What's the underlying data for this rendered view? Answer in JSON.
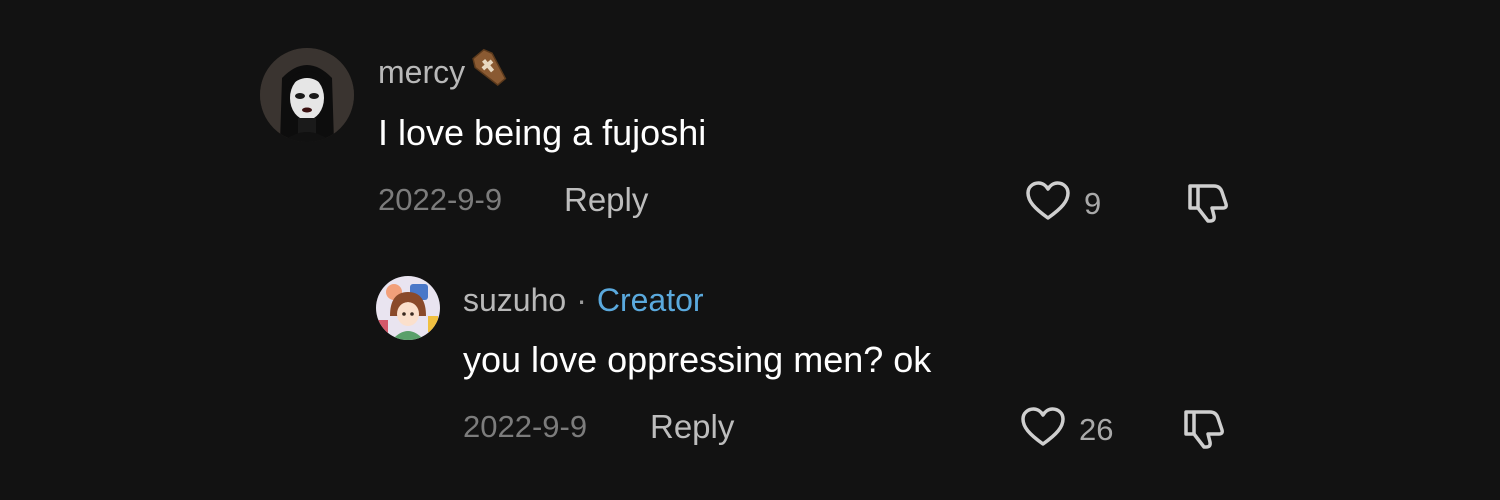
{
  "comments": [
    {
      "username": "mercy",
      "username_icon": "coffin-icon",
      "text": "I love being a fujoshi",
      "date": "2022-9-9",
      "reply_label": "Reply",
      "likes": "9"
    }
  ],
  "replies": [
    {
      "username": "suzuho",
      "separator": "·",
      "badge": "Creator",
      "text": "you love oppressing men? ok",
      "date": "2022-9-9",
      "reply_label": "Reply",
      "likes": "26"
    }
  ],
  "colors": {
    "background": "#121212",
    "creator_badge": "#5aa9dd",
    "username": "#b8b8b8",
    "date": "#7c7c7c"
  }
}
